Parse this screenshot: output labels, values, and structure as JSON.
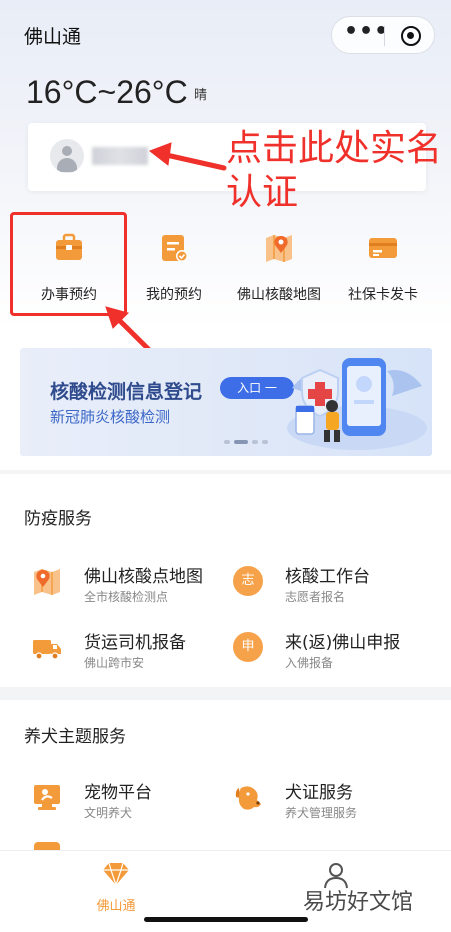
{
  "app": {
    "title": "佛山通"
  },
  "capsule": {
    "more_glyph": "•••"
  },
  "weather": {
    "temperature": "16°C~26°C",
    "condition": "晴"
  },
  "annotation": {
    "line1": "点击此处实名",
    "line2": "认证",
    "color": "#f0302a"
  },
  "services": [
    {
      "label": "办事预约",
      "icon": "briefcase-icon"
    },
    {
      "label": "我的预约",
      "icon": "appointment-list-icon"
    },
    {
      "label": "佛山核酸地图",
      "icon": "map-pin-icon"
    },
    {
      "label": "社保卡发卡",
      "icon": "bank-card-icon"
    }
  ],
  "banner": {
    "title": "核酸检测信息登记",
    "entry_label": "入口 一",
    "subtitle": "新冠肺炎核酸检测",
    "active_slide": 2,
    "slide_count": 4
  },
  "epidemic": {
    "title": "防疫服务",
    "items": [
      {
        "title": "佛山核酸点地图",
        "sub": "全市核酸检测点",
        "icon": "map-icon"
      },
      {
        "title": "核酸工作台",
        "sub": "志愿者报名",
        "icon": "volunteer-icon",
        "glyph": "志"
      },
      {
        "title": "货运司机报备",
        "sub": "佛山跨市安",
        "icon": "truck-icon"
      },
      {
        "title": "来(返)佛山申报",
        "sub": "入佛报备",
        "icon": "declare-icon",
        "glyph": "申"
      }
    ]
  },
  "pets": {
    "title": "养犬主题服务",
    "items": [
      {
        "title": "宠物平台",
        "sub": "文明养犬",
        "icon": "pet-platform-icon"
      },
      {
        "title": "犬证服务",
        "sub": "养犬管理服务",
        "icon": "dog-license-icon"
      }
    ]
  },
  "tabbar": {
    "tabs": [
      {
        "label": "佛山通",
        "icon": "diamond-icon",
        "active": true
      },
      {
        "label": "",
        "icon": "user-icon",
        "active": false
      }
    ]
  },
  "watermark": "易坊好文馆",
  "colors": {
    "accent": "#f39a3a",
    "brand_blue": "#3d6ee8",
    "annotation_red": "#f0302a"
  }
}
